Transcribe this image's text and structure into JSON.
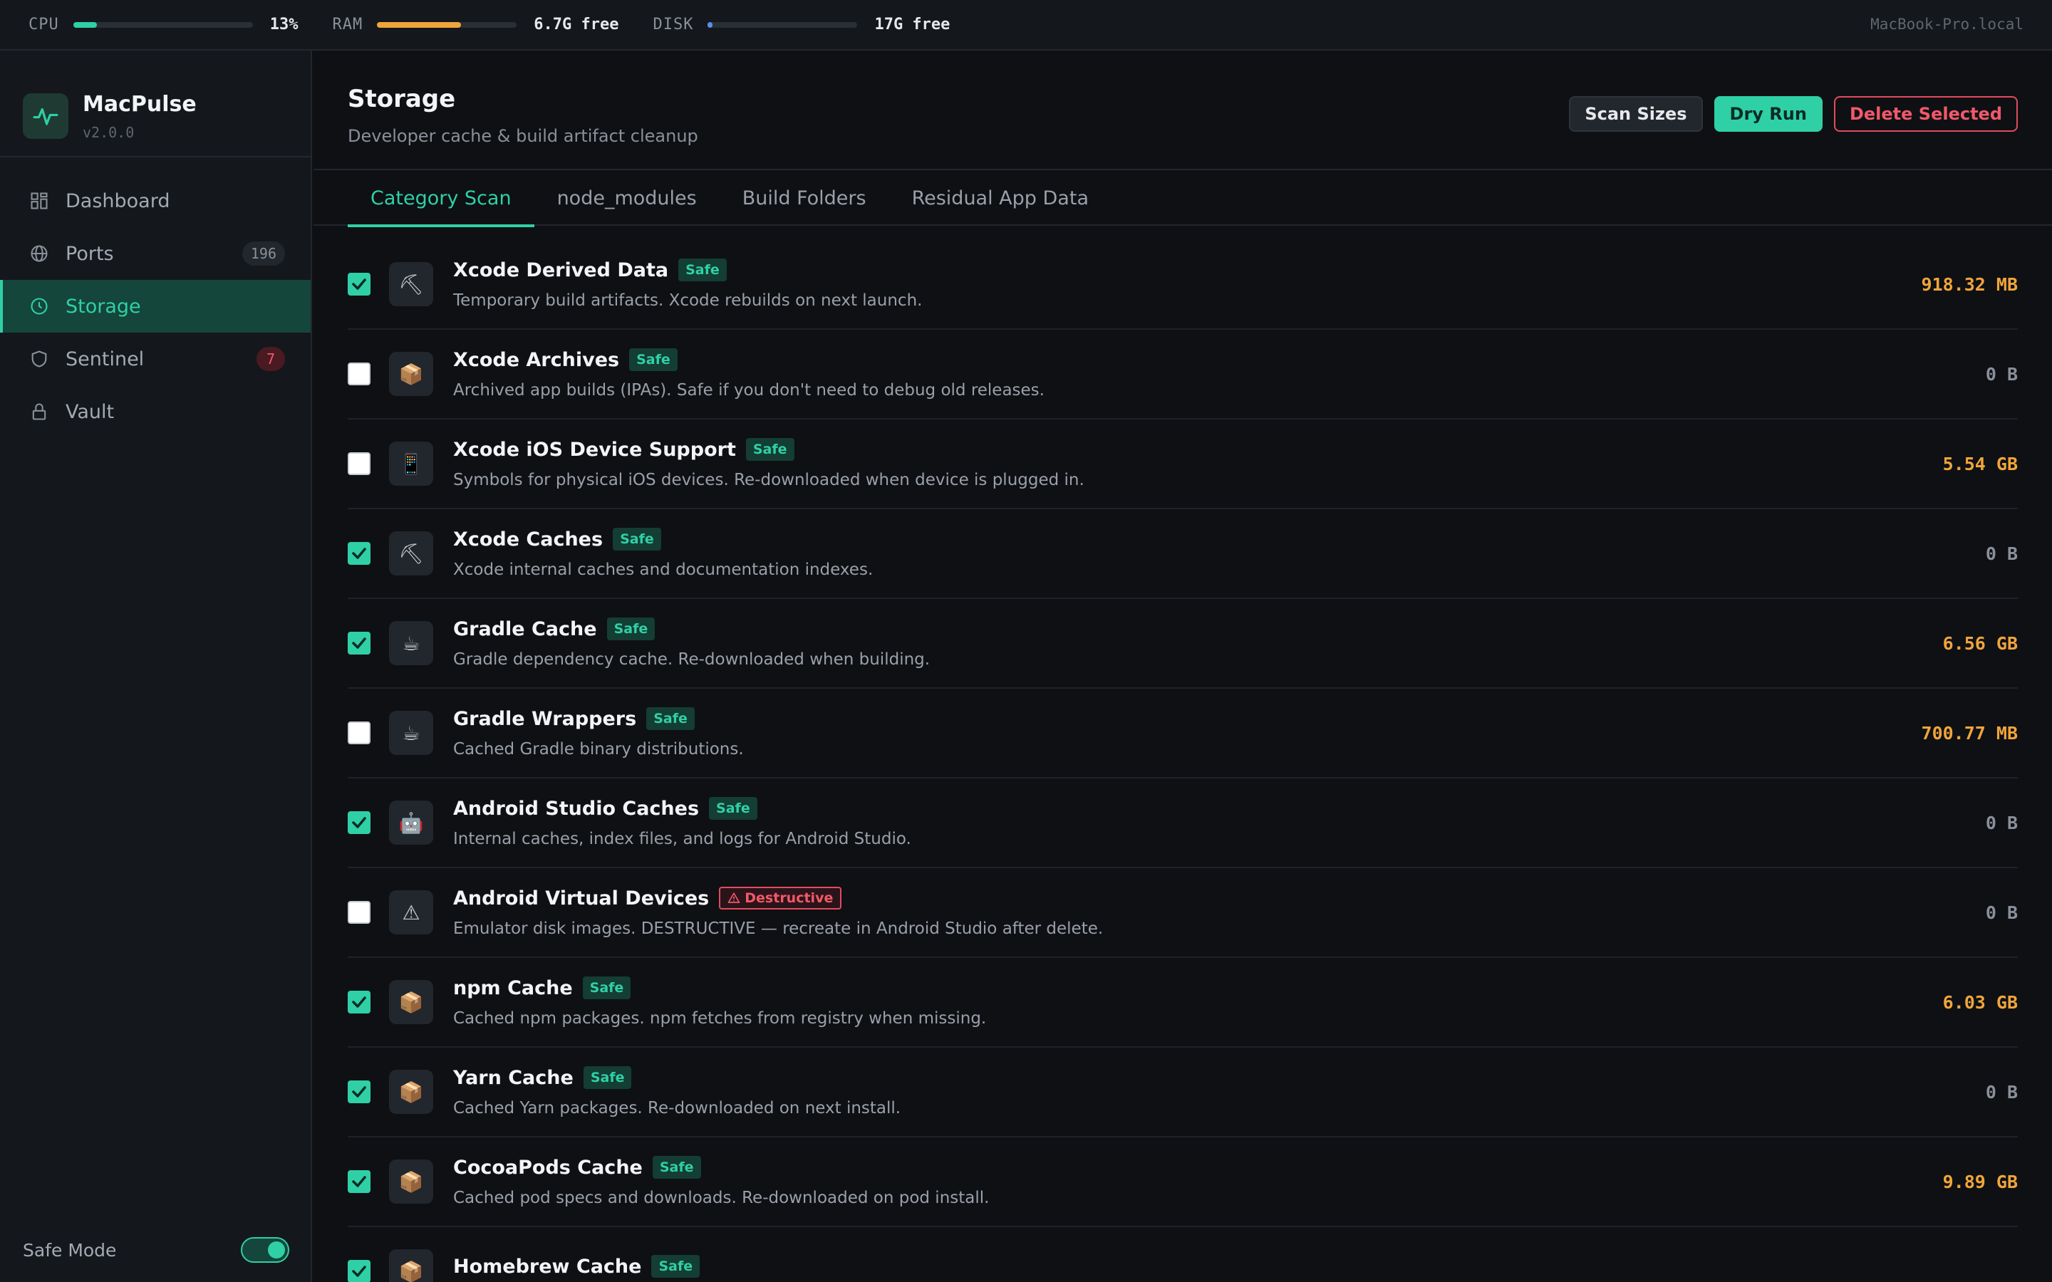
{
  "stats": {
    "cpu": {
      "label": "CPU",
      "value": "13%",
      "level": 0.13,
      "color": "#2fd0a6"
    },
    "ram": {
      "label": "RAM",
      "value": "6.7G free",
      "level": 0.6,
      "color": "#f0a53a"
    },
    "disk": {
      "label": "DISK",
      "value": "17G free",
      "level": 0.03,
      "color": "#5b8def"
    },
    "hostname": "MacBook-Pro.local"
  },
  "app": {
    "name": "MacPulse",
    "version": "v2.0.0"
  },
  "sidebar": {
    "items": [
      {
        "label": "Dashboard",
        "icon": "grid-icon",
        "count": ""
      },
      {
        "label": "Ports",
        "icon": "globe-icon",
        "count": "196"
      },
      {
        "label": "Storage",
        "icon": "clock-icon",
        "count": ""
      },
      {
        "label": "Sentinel",
        "icon": "shield-icon",
        "count": "7"
      },
      {
        "label": "Vault",
        "icon": "lock-icon",
        "count": ""
      }
    ],
    "safe_mode_label": "Safe Mode"
  },
  "header": {
    "title": "Storage",
    "subtitle": "Developer cache & build artifact cleanup",
    "scan_label": "Scan Sizes",
    "dry_run_label": "Dry Run",
    "delete_label": "Delete Selected"
  },
  "tabs": [
    {
      "label": "Category Scan"
    },
    {
      "label": "node_modules"
    },
    {
      "label": "Build Folders"
    },
    {
      "label": "Residual App Data"
    }
  ],
  "items": [
    {
      "name": "Xcode Derived Data",
      "badge": "Safe",
      "desc": "Temporary build artifacts. Xcode rebuilds on next launch.",
      "size": "918.32 MB",
      "checked": true,
      "icon": "⛏"
    },
    {
      "name": "Xcode Archives",
      "badge": "Safe",
      "desc": "Archived app builds (IPAs). Safe if you don't need to debug old releases.",
      "size": "0 B",
      "checked": false,
      "icon": "📦"
    },
    {
      "name": "Xcode iOS Device Support",
      "badge": "Safe",
      "desc": "Symbols for physical iOS devices. Re-downloaded when device is plugged in.",
      "size": "5.54 GB",
      "checked": false,
      "icon": "📱"
    },
    {
      "name": "Xcode Caches",
      "badge": "Safe",
      "desc": "Xcode internal caches and documentation indexes.",
      "size": "0 B",
      "checked": true,
      "icon": "⛏"
    },
    {
      "name": "Gradle Cache",
      "badge": "Safe",
      "desc": "Gradle dependency cache. Re-downloaded when building.",
      "size": "6.56 GB",
      "checked": true,
      "icon": "☕"
    },
    {
      "name": "Gradle Wrappers",
      "badge": "Safe",
      "desc": "Cached Gradle binary distributions.",
      "size": "700.77 MB",
      "checked": false,
      "icon": "☕"
    },
    {
      "name": "Android Studio Caches",
      "badge": "Safe",
      "desc": "Internal caches, index files, and logs for Android Studio.",
      "size": "0 B",
      "checked": true,
      "icon": "🤖"
    },
    {
      "name": "Android Virtual Devices",
      "badge": "Destructive",
      "desc": "Emulator disk images. DESTRUCTIVE — recreate in Android Studio after delete.",
      "size": "0 B",
      "checked": false,
      "icon": "⚠"
    },
    {
      "name": "npm Cache",
      "badge": "Safe",
      "desc": "Cached npm packages. npm fetches from registry when missing.",
      "size": "6.03 GB",
      "checked": true,
      "icon": "📦"
    },
    {
      "name": "Yarn Cache",
      "badge": "Safe",
      "desc": "Cached Yarn packages. Re-downloaded on next install.",
      "size": "0 B",
      "checked": true,
      "icon": "📦"
    },
    {
      "name": "CocoaPods Cache",
      "badge": "Safe",
      "desc": "Cached pod specs and downloads. Re-downloaded on pod install.",
      "size": "9.89 GB",
      "checked": true,
      "icon": "📦"
    },
    {
      "name": "Homebrew Cache",
      "badge": "Safe",
      "desc": "",
      "size": "",
      "checked": true,
      "icon": "📦"
    }
  ]
}
